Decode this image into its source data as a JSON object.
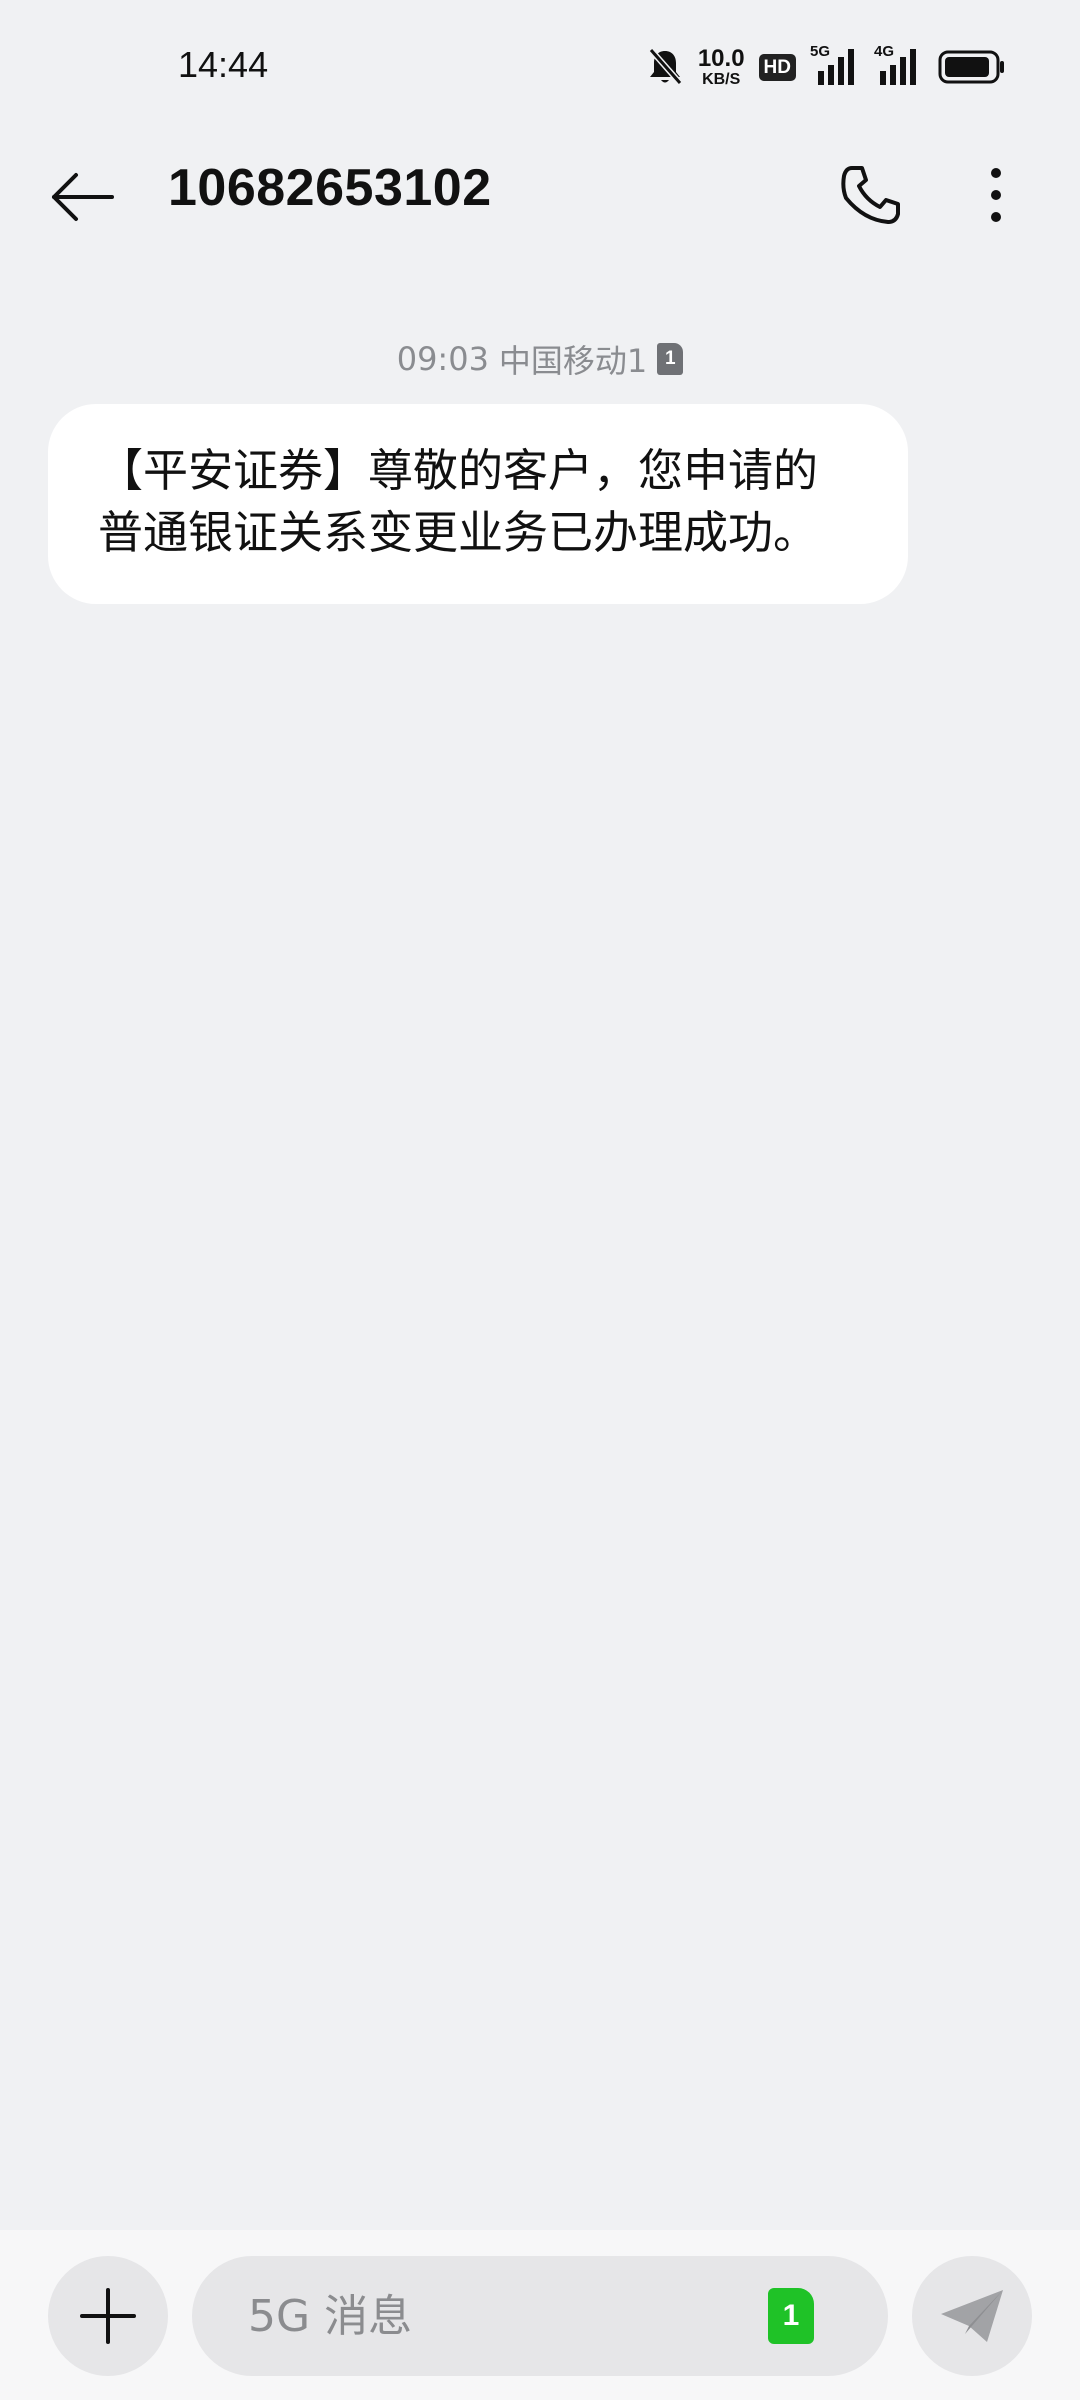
{
  "status_bar": {
    "time": "14:44",
    "net_speed_value": "10.0",
    "net_speed_unit": "KB/S",
    "hd_badge": "HD",
    "signal1_label": "5G",
    "signal2_label": "4G",
    "icons": [
      "bell-off-icon",
      "battery-icon"
    ]
  },
  "header": {
    "title": "10682653102",
    "icons": [
      "back-arrow-icon",
      "phone-icon",
      "more-vertical-icon"
    ]
  },
  "conversation": {
    "meta_time": "09:03",
    "meta_carrier": "中国移动1",
    "meta_sim": "1",
    "message_text": "【平安证券】尊敬的客户，您申请的普通银证关系变更业务已办理成功。"
  },
  "input_bar": {
    "placeholder": "5G 消息",
    "sim_label": "1",
    "icons": [
      "plus-icon",
      "send-icon"
    ]
  },
  "colors": {
    "background": "#f0f1f3",
    "bubble": "#ffffff",
    "sim_green": "#1fc227",
    "meta_text": "#8a8c90"
  }
}
